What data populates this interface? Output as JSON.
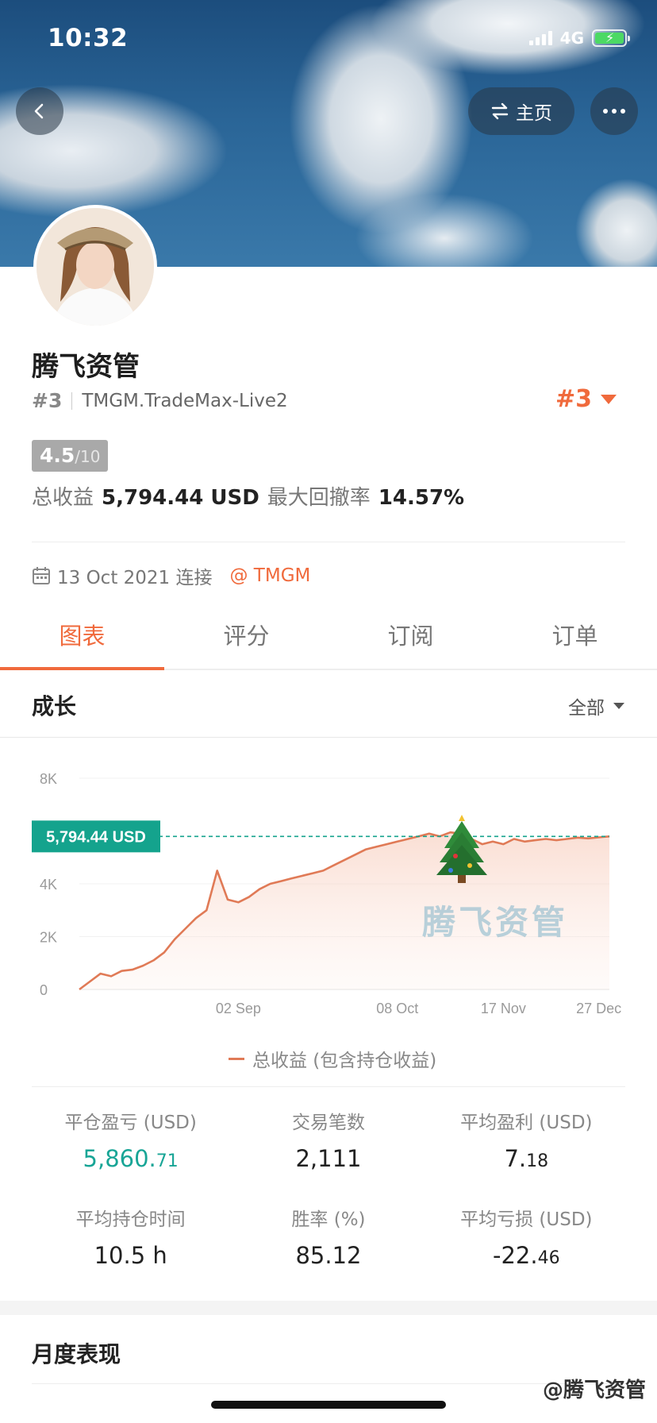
{
  "status_bar": {
    "time": "10:32",
    "network": "4G",
    "battery_icon": "battery-charging-icon"
  },
  "header": {
    "back_icon": "chevron-left-icon",
    "home_label": "主页",
    "home_icon": "swap-arrows-icon",
    "more_icon": "more-dots-icon"
  },
  "profile": {
    "name": "腾飞资管",
    "rank": "#3",
    "account": "TMGM.TradeMax-Live2",
    "rank_right": "#3",
    "score": "4.5",
    "score_max": "/10",
    "total_profit_label": "总收益",
    "total_profit_value": "5,794.44 USD",
    "max_drawdown_label": "最大回撤率",
    "max_drawdown_value": "14.57%",
    "joined_date": "13 Oct 2021 连接",
    "broker": "@ TMGM"
  },
  "tabs": [
    {
      "label": "图表",
      "active": true
    },
    {
      "label": "评分",
      "active": false
    },
    {
      "label": "订阅",
      "active": false
    },
    {
      "label": "订单",
      "active": false
    }
  ],
  "growth": {
    "title": "成长",
    "filter": "全部"
  },
  "chart_data": {
    "type": "area",
    "series": [
      {
        "name": "总收益 (包含持仓收益)",
        "x": [
          0,
          2,
          4,
          6,
          8,
          10,
          12,
          14,
          16,
          18,
          20,
          22,
          24,
          26,
          28,
          30,
          32,
          34,
          36,
          38,
          40,
          42,
          44,
          46,
          48,
          50,
          52,
          54,
          56,
          58,
          60,
          62,
          64,
          66,
          68,
          70,
          72,
          74,
          76,
          78,
          80,
          82,
          84,
          86,
          88,
          90,
          92,
          94,
          96,
          98,
          100
        ],
        "y": [
          0,
          300,
          600,
          500,
          700,
          750,
          900,
          1100,
          1400,
          1900,
          2300,
          2700,
          3000,
          4500,
          3400,
          3300,
          3500,
          3800,
          4000,
          4100,
          4200,
          4300,
          4400,
          4500,
          4700,
          4900,
          5100,
          5300,
          5400,
          5500,
          5600,
          5700,
          5800,
          5900,
          5800,
          5950,
          5900,
          5700,
          5500,
          5600,
          5500,
          5700,
          5600,
          5650,
          5700,
          5650,
          5700,
          5750,
          5720,
          5760,
          5794
        ]
      }
    ],
    "x_ticks": [
      "02 Sep",
      "08 Oct",
      "17 Nov",
      "27 Dec"
    ],
    "y_ticks": [
      "8K",
      "4K",
      "2K",
      "0"
    ],
    "ylim": [
      0,
      8000
    ],
    "current_value_label": "5,794.44 USD",
    "current_value": 5794.44,
    "watermark": "腾飞资管",
    "line_color": "#e07a56",
    "marker_color": "#14a38d"
  },
  "legend": {
    "label": "总收益 (包含持仓收益)"
  },
  "stats": [
    {
      "label": "平仓盈亏 (USD)",
      "value_main": "5,860.",
      "value_small": "71",
      "positive": true
    },
    {
      "label": "交易笔数",
      "value_main": "2,111",
      "value_small": "",
      "positive": false
    },
    {
      "label": "平均盈利 (USD)",
      "value_main": "7.",
      "value_small": "18",
      "positive": false
    },
    {
      "label": "平均持仓时间",
      "value_main": "10.5 h",
      "value_small": "",
      "positive": false
    },
    {
      "label": "胜率 (%)",
      "value_main": "85.12",
      "value_small": "",
      "positive": false
    },
    {
      "label": "平均亏损 (USD)",
      "value_main": "-22.",
      "value_small": "46",
      "positive": false
    }
  ],
  "monthly": {
    "title": "月度表现"
  },
  "footer": {
    "watermark": "@腾飞资管"
  },
  "colors": {
    "accent": "#f06a3c",
    "positive": "#18a596"
  }
}
